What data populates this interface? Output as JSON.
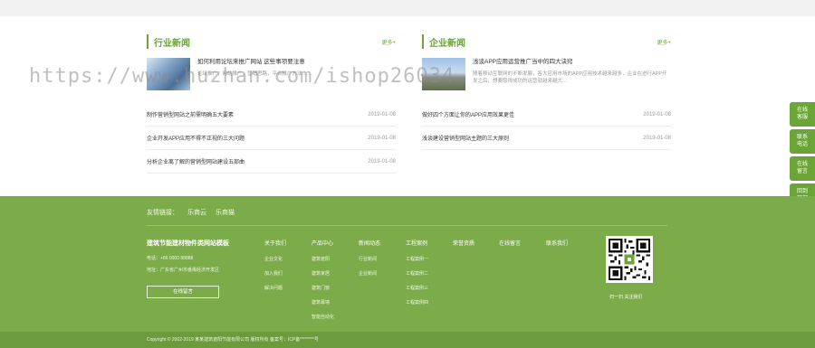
{
  "industry_news": {
    "title": "行业新闻",
    "more": "更多+",
    "feature": {
      "title": "如何利用论坛来推广网站 这些事项要注意",
      "desc": "论坛推广，网站推广，营销思路，平台推广方法……"
    },
    "items": [
      {
        "title": "制作营销型网站之前需明确五大要素",
        "date": "2019-01-08"
      },
      {
        "title": "企业开发APP应用不得不正视的三大问题",
        "date": "2019-01-08"
      },
      {
        "title": "分析企业离了解的营销型网站建设五部曲",
        "date": "2019-01-08"
      }
    ]
  },
  "enterprise_news": {
    "title": "企业新闻",
    "more": "更多+",
    "feature": {
      "title": "浅谈APP应用运营推广当中的四大诀窍",
      "desc": "随着移动互联网的不断发展，各大应用市场的APP应用技术越来越多，企业在进行APP开发之后，想要取得成功的运营就越来越大…"
    },
    "items": [
      {
        "title": "做好四个方面让你的APP应用效果更佳",
        "date": "2019-01-08"
      },
      {
        "title": "浅谈建设营销型网站主题的三大原则",
        "date": "2019-01-08"
      }
    ]
  },
  "watermark": "https://www.huzhan.com/ishop26034",
  "side_buttons": [
    {
      "line1": "在线",
      "line2": "客服"
    },
    {
      "line1": "联系",
      "line2": "电话"
    },
    {
      "line1": "在线",
      "line2": "留言"
    },
    {
      "line1": "回到",
      "line2": "顶部"
    }
  ],
  "footer": {
    "friend_label": "友情链接：",
    "friend_links": [
      "乐商云",
      "乐商猫"
    ],
    "company_name": "建筑节能建材物件类网站模板",
    "phone": "电话：+86 0000 88888",
    "address": "地址：广东省广州市番禺经济开发区",
    "message_button": "在线留言",
    "columns": [
      {
        "title": "关于我们",
        "links": [
          "企业文化",
          "加入我们",
          "解决问题"
        ]
      },
      {
        "title": "产品中心",
        "links": [
          "建筑遮阳",
          "建筑家居",
          "建筑门窗",
          "建筑幕墙",
          "智能自动化"
        ]
      },
      {
        "title": "新闻动态",
        "links": [
          "行业新闻",
          "企业新闻"
        ]
      },
      {
        "title": "工程案例",
        "links": [
          "工程案例一",
          "工程案例二",
          "工程案例三",
          "工程案例四"
        ]
      },
      {
        "title": "荣誉资质",
        "links": []
      },
      {
        "title": "在线留言",
        "links": []
      },
      {
        "title": "联系我们",
        "links": []
      }
    ],
    "qr_caption": "扫一扫  关注我们",
    "copyright": "Copyright © 2002-2019 某某建筑遮阳节能有限公司 版权所有  备案号：ICP备********号"
  },
  "colors": {
    "accent": "#6aa536",
    "footer_bg": "#7bac49",
    "copyright_bg": "#6a9b3c"
  }
}
